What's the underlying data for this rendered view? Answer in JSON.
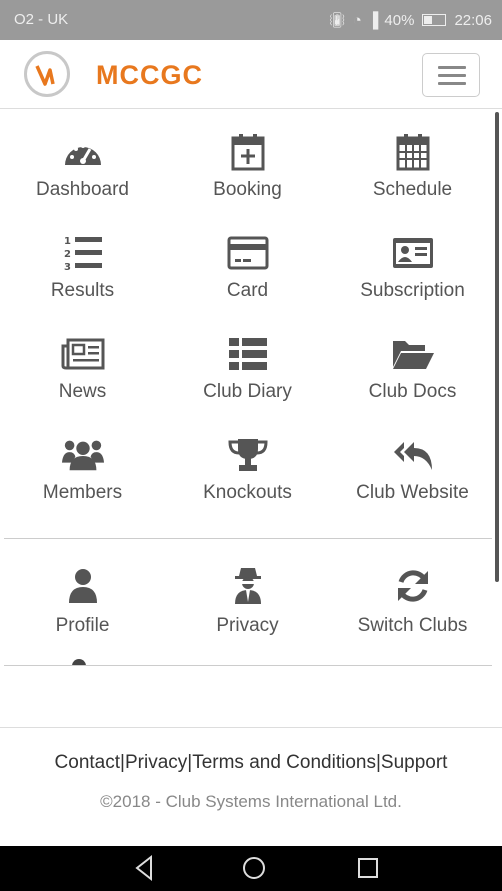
{
  "status_bar": {
    "carrier": "O2 - UK",
    "battery": "40%",
    "battery_level": 0.4,
    "time": "22:06"
  },
  "header": {
    "brand": "MCCGC"
  },
  "menu": [
    {
      "label": "Dashboard",
      "icon": "dashboard-icon"
    },
    {
      "label": "Booking",
      "icon": "calendar-plus-icon"
    },
    {
      "label": "Schedule",
      "icon": "calendar-grid-icon"
    },
    {
      "label": "Results",
      "icon": "ordered-list-icon"
    },
    {
      "label": "Card",
      "icon": "credit-card-icon"
    },
    {
      "label": "Subscription",
      "icon": "id-card-icon"
    },
    {
      "label": "News",
      "icon": "newspaper-icon"
    },
    {
      "label": "Club Diary",
      "icon": "list-icon"
    },
    {
      "label": "Club Docs",
      "icon": "folder-open-icon"
    },
    {
      "label": "Members",
      "icon": "users-icon"
    },
    {
      "label": "Knockouts",
      "icon": "trophy-icon"
    },
    {
      "label": "Club Website",
      "icon": "reply-all-icon"
    }
  ],
  "account_menu": [
    {
      "label": "Profile",
      "icon": "user-icon"
    },
    {
      "label": "Privacy",
      "icon": "user-secret-icon"
    },
    {
      "label": "Switch Clubs",
      "icon": "refresh-icon"
    }
  ],
  "footer": {
    "links": [
      "Contact",
      "Privacy",
      "Terms and Conditions",
      "Support"
    ],
    "copyright": "©2018 - Club Systems International Ltd."
  },
  "colors": {
    "brand": "#e8781e",
    "icon": "#555555",
    "statusbar": "#9a9a9a"
  }
}
